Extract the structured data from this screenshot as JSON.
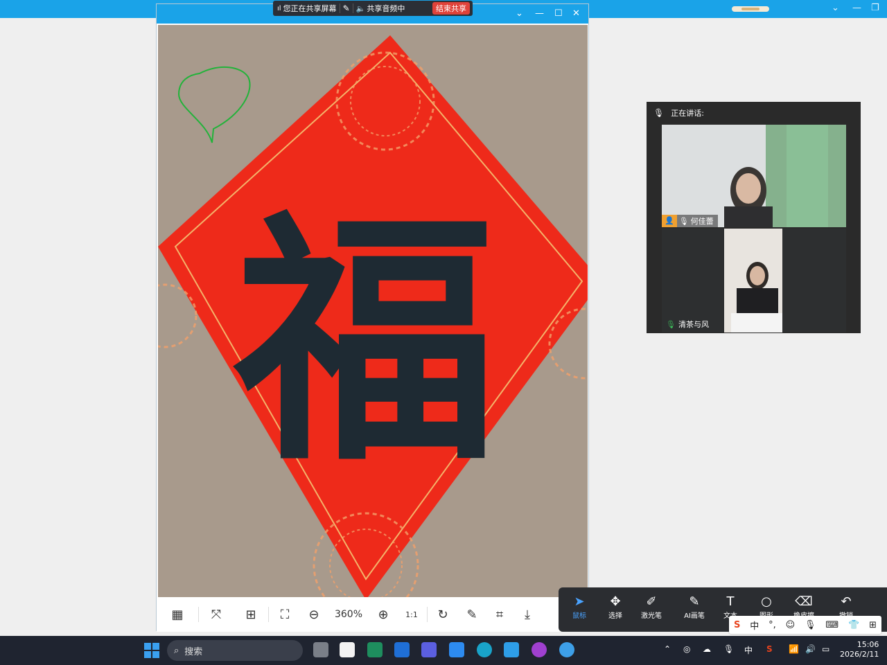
{
  "share_bar": {
    "status": "您正在共享屏幕",
    "audio": "共享音频中",
    "stop": "结束共享"
  },
  "viewer": {
    "artwork_character": "福",
    "zoom_level": "360%",
    "actual_size_label": "1:1"
  },
  "video_panel": {
    "speaking_label": "正在讲话:",
    "participants": [
      {
        "name": "何佳蕾"
      },
      {
        "name": "清茶与风"
      }
    ]
  },
  "draw_toolbar": {
    "items": [
      {
        "label": "鼠标",
        "icon": "cursor-icon"
      },
      {
        "label": "选择",
        "icon": "move-icon"
      },
      {
        "label": "激光笔",
        "icon": "laser-pen-icon"
      },
      {
        "label": "AI画笔",
        "icon": "ai-brush-icon"
      },
      {
        "label": "文本",
        "icon": "text-icon"
      },
      {
        "label": "图形",
        "icon": "shape-icon"
      },
      {
        "label": "橡皮擦",
        "icon": "eraser-icon"
      },
      {
        "label": "撤销",
        "icon": "undo-icon"
      }
    ]
  },
  "ime": {
    "mode": "中"
  },
  "taskbar": {
    "search_placeholder": "搜索",
    "tray_lang": "中",
    "time": "15:06",
    "date": "2026/2/11"
  },
  "colors": {
    "accent": "#1aa3e8",
    "paper_red": "#ee2a1a",
    "ink": "#1e2a33",
    "stop_red": "#e0433a"
  }
}
